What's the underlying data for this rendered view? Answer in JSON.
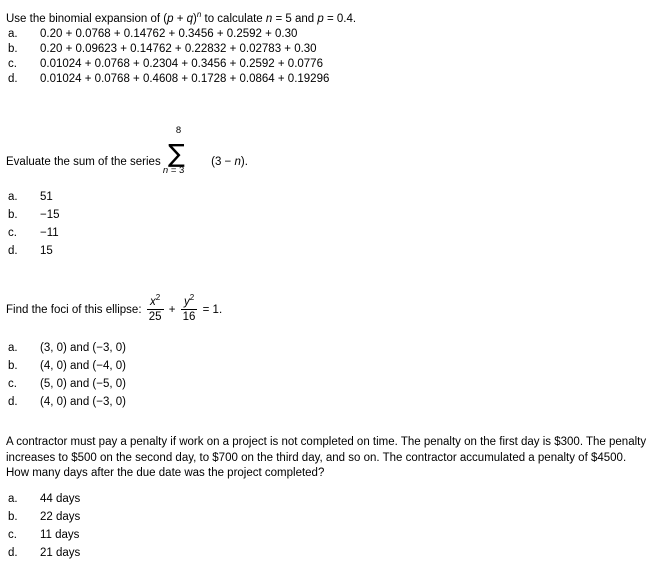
{
  "document": {
    "type": "math-quiz",
    "text_color": "#000000",
    "background_color": "#ffffff"
  },
  "questions": [
    {
      "id": "q1",
      "stem_parts": {
        "before_expr": "Use the binomial expansion of (",
        "var_p": "p",
        "plus": " + ",
        "var_q": "q",
        "close_paren": ")",
        "exponent": "n",
        "after_expr": " to calculate ",
        "n_var": "n",
        "n_value": " = 5 and ",
        "p_var": "p",
        "p_value": " = 0.4."
      },
      "stem_plain": "Use the binomial expansion of (p + q)n to calculate n = 5 and p = 0.4.",
      "options": [
        {
          "letter": "a.",
          "text": "0.20 + 0.0768 + 0.14762 + 0.3456 + 0.2592 + 0.30"
        },
        {
          "letter": "b.",
          "text": "0.20 + 0.09623 + 0.14762 + 0.22832 + 0.02783 + 0.30"
        },
        {
          "letter": "c.",
          "text": "0.01024 + 0.0768 + 0.2304 + 0.3456 + 0.2592 + 0.0776"
        },
        {
          "letter": "d.",
          "text": "0.01024 + 0.0768 + 0.4608 + 0.1728 + 0.0864 + 0.19296"
        }
      ]
    },
    {
      "id": "q2",
      "stem_parts": {
        "lead": "Evaluate the sum of the series",
        "sum_upper": "8",
        "sum_symbol": "∑",
        "sum_lower_var": "n",
        "sum_lower_rest": " = 3",
        "expr_open": "(3 − ",
        "expr_var": "n",
        "expr_close": ")."
      },
      "stem_plain": "Evaluate the sum of the series ∑ from n = 3 to 8 of (3 − n).",
      "options": [
        {
          "letter": "a.",
          "text": "51"
        },
        {
          "letter": "b.",
          "text": "−15"
        },
        {
          "letter": "c.",
          "text": "−11"
        },
        {
          "letter": "d.",
          "text": "15"
        }
      ]
    },
    {
      "id": "q3",
      "stem_parts": {
        "lead": "Find the foci of this ellipse:",
        "frac1_num_var": "x",
        "frac1_num_exp": "2",
        "frac1_den": "25",
        "operator": "+",
        "frac2_num_var": "y",
        "frac2_num_exp": "2",
        "frac2_den": "16",
        "tail": "= 1."
      },
      "stem_plain": "Find the foci of this ellipse: x²/25 + y²/16 = 1.",
      "options": [
        {
          "letter": "a.",
          "text": "(3, 0) and (−3, 0)"
        },
        {
          "letter": "b.",
          "text": "(4, 0) and (−4, 0)"
        },
        {
          "letter": "c.",
          "text": "(5, 0) and (−5, 0)"
        },
        {
          "letter": "d.",
          "text": "(4, 0) and (−3, 0)"
        }
      ]
    },
    {
      "id": "q4",
      "stem_plain": "A contractor must pay a penalty if work on a project is not completed on time. The penalty on the first day is $300. The penalty increases to $500 on the second day, to $700 on the third day, and so on. The contractor accumulated a penalty of $4500. How many days after the due date was the project completed?",
      "options": [
        {
          "letter": "a.",
          "text": "44 days"
        },
        {
          "letter": "b.",
          "text": "22 days"
        },
        {
          "letter": "c.",
          "text": "11 days"
        },
        {
          "letter": "d.",
          "text": "21 days"
        }
      ]
    }
  ]
}
